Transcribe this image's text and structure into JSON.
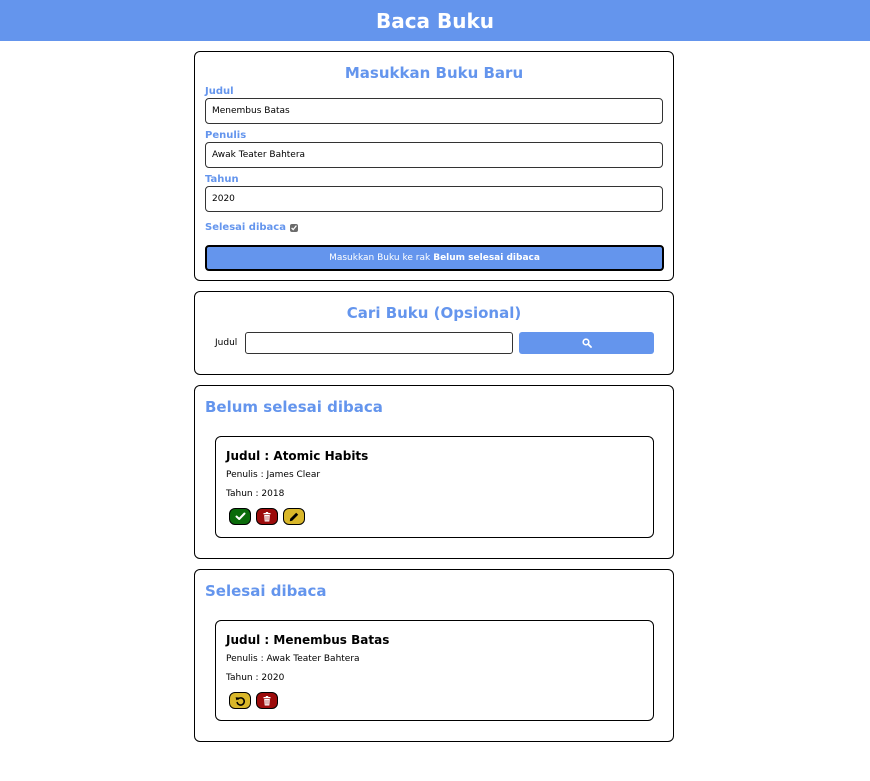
{
  "header": {
    "title": "Baca Buku"
  },
  "input_form": {
    "title": "Masukkan Buku Baru",
    "title_label": "Judul",
    "title_value": "Menembus Batas",
    "author_label": "Penulis",
    "author_value": "Awak Teater Bahtera",
    "year_label": "Tahun",
    "year_value": "2020",
    "complete_label": "Selesai dibaca",
    "complete_checked": true,
    "submit_prefix": "Masukkan Buku ke rak",
    "submit_target": "Belum selesai dibaca"
  },
  "search": {
    "title": "Cari Buku (Opsional)",
    "label": "Judul",
    "value": "",
    "button_icon": "search-icon"
  },
  "unread_shelf": {
    "title": "Belum selesai dibaca",
    "books": [
      {
        "title": "Judul : Atomic Habits",
        "author": "Penulis : James Clear",
        "year": "Tahun : 2018",
        "actions": [
          "check-icon",
          "trash-icon",
          "pencil-icon"
        ]
      }
    ]
  },
  "read_shelf": {
    "title": "Selesai dibaca",
    "books": [
      {
        "title": "Judul : Menembus Batas",
        "author": "Penulis : Awak Teater Bahtera",
        "year": "Tahun : 2020",
        "actions": [
          "undo-icon",
          "trash-icon"
        ]
      }
    ]
  },
  "colors": {
    "accent": "#6495ed",
    "done_button": "#0b6b0b",
    "delete_button": "#9c0b0b",
    "edit_button": "#d9b72a"
  }
}
